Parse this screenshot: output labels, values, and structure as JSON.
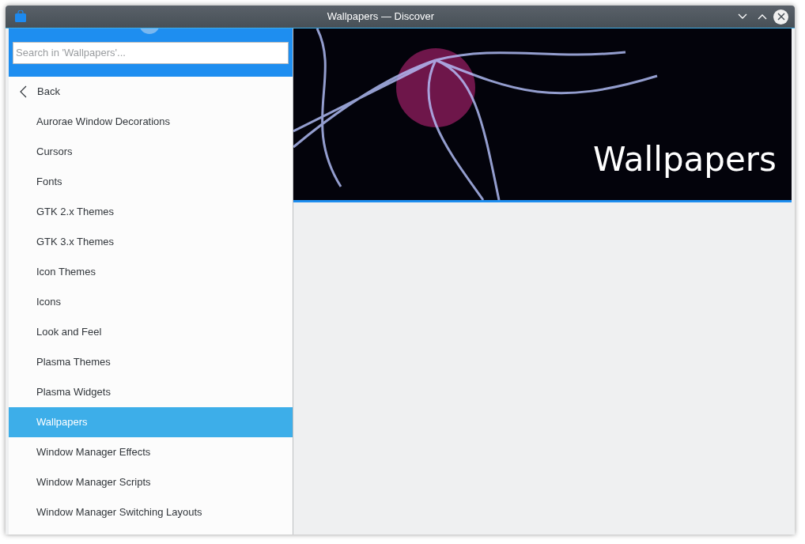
{
  "window": {
    "title": "Wallpapers — Discover"
  },
  "search": {
    "placeholder": "Search in 'Wallpapers'..."
  },
  "back": {
    "label": "Back"
  },
  "categories": [
    {
      "label": "Aurorae Window Decorations",
      "selected": false
    },
    {
      "label": "Cursors",
      "selected": false
    },
    {
      "label": "Fonts",
      "selected": false
    },
    {
      "label": "GTK 2.x Themes",
      "selected": false
    },
    {
      "label": "GTK 3.x Themes",
      "selected": false
    },
    {
      "label": "Icon Themes",
      "selected": false
    },
    {
      "label": "Icons",
      "selected": false
    },
    {
      "label": "Look and Feel",
      "selected": false
    },
    {
      "label": "Plasma Themes",
      "selected": false
    },
    {
      "label": "Plasma Widgets",
      "selected": false
    },
    {
      "label": "Wallpapers",
      "selected": true
    },
    {
      "label": "Window Manager Effects",
      "selected": false
    },
    {
      "label": "Window Manager Scripts",
      "selected": false
    },
    {
      "label": "Window Manager Switching Layouts",
      "selected": false
    }
  ],
  "banner": {
    "title": "Wallpapers"
  }
}
